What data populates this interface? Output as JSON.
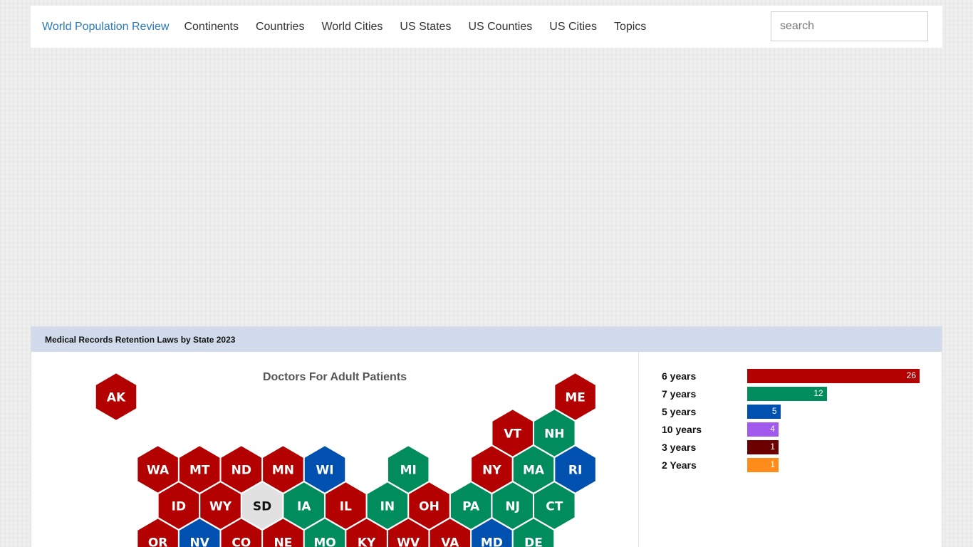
{
  "nav": {
    "brand": "World Population Review",
    "links": [
      "Continents",
      "Countries",
      "World Cities",
      "US States",
      "US Counties",
      "US Cities",
      "Topics"
    ],
    "search_placeholder": "search"
  },
  "panel": {
    "title": "Medical Records Retention Laws by State 2023",
    "map_title": "Doctors For Adult Patients"
  },
  "colors": {
    "6 years": "#b30000",
    "7 years": "#008c5c",
    "5 years": "#0050b0",
    "10 years": "#a259ee",
    "3 years": "#6a0000",
    "2 Years": "#ff8c1a",
    "none": "#e1e1e1"
  },
  "legend": [
    {
      "label": "6 years",
      "count": 26
    },
    {
      "label": "7 years",
      "count": 12
    },
    {
      "label": "5 years",
      "count": 5
    },
    {
      "label": "10 years",
      "count": 4
    },
    {
      "label": "3 years",
      "count": 1
    },
    {
      "label": "2 Years",
      "count": 1
    }
  ],
  "states": [
    {
      "abbr": "AK",
      "row": 0,
      "col": 0,
      "cat": "6 years"
    },
    {
      "abbr": "ME",
      "row": 0,
      "col": 11,
      "cat": "6 years"
    },
    {
      "abbr": "VT",
      "row": 1,
      "col": 9,
      "cat": "6 years"
    },
    {
      "abbr": "NH",
      "row": 1,
      "col": 10,
      "cat": "7 years"
    },
    {
      "abbr": "WA",
      "row": 2,
      "col": 1,
      "cat": "6 years"
    },
    {
      "abbr": "MT",
      "row": 2,
      "col": 2,
      "cat": "6 years"
    },
    {
      "abbr": "ND",
      "row": 2,
      "col": 3,
      "cat": "6 years"
    },
    {
      "abbr": "MN",
      "row": 2,
      "col": 4,
      "cat": "6 years"
    },
    {
      "abbr": "WI",
      "row": 2,
      "col": 5,
      "cat": "5 years"
    },
    {
      "abbr": "MI",
      "row": 2,
      "col": 7,
      "cat": "7 years"
    },
    {
      "abbr": "NY",
      "row": 2,
      "col": 9,
      "cat": "6 years"
    },
    {
      "abbr": "MA",
      "row": 2,
      "col": 10,
      "cat": "7 years"
    },
    {
      "abbr": "RI",
      "row": 2,
      "col": 11,
      "cat": "5 years"
    },
    {
      "abbr": "ID",
      "row": 3,
      "col": 1,
      "cat": "6 years"
    },
    {
      "abbr": "WY",
      "row": 3,
      "col": 2,
      "cat": "6 years"
    },
    {
      "abbr": "SD",
      "row": 3,
      "col": 3,
      "cat": "none"
    },
    {
      "abbr": "IA",
      "row": 3,
      "col": 4,
      "cat": "7 years"
    },
    {
      "abbr": "IL",
      "row": 3,
      "col": 5,
      "cat": "6 years"
    },
    {
      "abbr": "IN",
      "row": 3,
      "col": 6,
      "cat": "7 years"
    },
    {
      "abbr": "OH",
      "row": 3,
      "col": 7,
      "cat": "6 years"
    },
    {
      "abbr": "PA",
      "row": 3,
      "col": 8,
      "cat": "7 years"
    },
    {
      "abbr": "NJ",
      "row": 3,
      "col": 9,
      "cat": "7 years"
    },
    {
      "abbr": "CT",
      "row": 3,
      "col": 10,
      "cat": "7 years"
    },
    {
      "abbr": "OR",
      "row": 4,
      "col": 1,
      "cat": "6 years"
    },
    {
      "abbr": "NV",
      "row": 4,
      "col": 2,
      "cat": "5 years"
    },
    {
      "abbr": "CO",
      "row": 4,
      "col": 3,
      "cat": "6 years"
    },
    {
      "abbr": "NE",
      "row": 4,
      "col": 4,
      "cat": "6 years"
    },
    {
      "abbr": "MO",
      "row": 4,
      "col": 5,
      "cat": "7 years"
    },
    {
      "abbr": "KY",
      "row": 4,
      "col": 6,
      "cat": "6 years"
    },
    {
      "abbr": "WV",
      "row": 4,
      "col": 7,
      "cat": "6 years"
    },
    {
      "abbr": "VA",
      "row": 4,
      "col": 8,
      "cat": "6 years"
    },
    {
      "abbr": "MD",
      "row": 4,
      "col": 9,
      "cat": "5 years"
    },
    {
      "abbr": "DE",
      "row": 4,
      "col": 10,
      "cat": "7 years"
    }
  ]
}
